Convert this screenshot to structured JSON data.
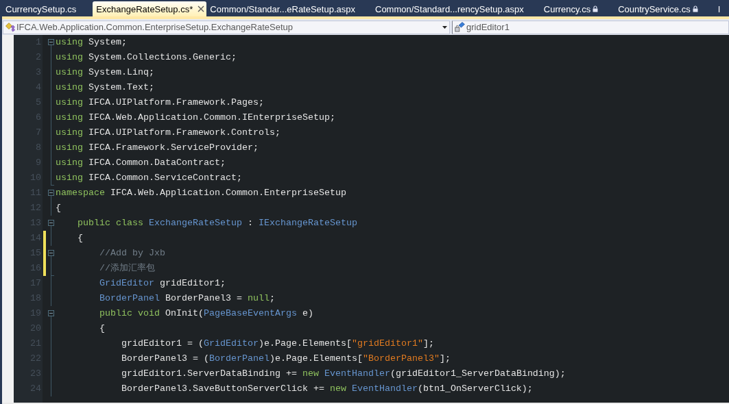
{
  "tabs": [
    {
      "label": "CurrencySetup.cs",
      "selected": false,
      "locked": false
    },
    {
      "label": "ExchangeRateSetup.cs*",
      "selected": true,
      "locked": false
    },
    {
      "label": "Common/Standar...eRateSetup.aspx",
      "selected": false,
      "locked": false
    },
    {
      "label": "Common/Standard...rencySetup.aspx",
      "selected": false,
      "locked": false
    },
    {
      "label": "Currency.cs",
      "selected": false,
      "locked": true
    },
    {
      "label": "CountryService.cs",
      "selected": false,
      "locked": true
    },
    {
      "label": "I",
      "selected": false,
      "locked": false
    }
  ],
  "navigation_bar": {
    "type_dropdown": "IFCA.Web.Application.Common.EnterpriseSetup.ExchangeRateSetup",
    "member_dropdown": "gridEditor1"
  },
  "editor": {
    "lines": [
      {
        "number": "1",
        "foldable": true,
        "fold_end": false,
        "changed": false,
        "tokens": [
          {
            "kind": "keyword",
            "text": "using"
          },
          {
            "kind": "plain",
            "text": " System;"
          }
        ]
      },
      {
        "number": "2",
        "foldable": false,
        "fold_end": false,
        "changed": false,
        "tokens": [
          {
            "kind": "keyword",
            "text": "using"
          },
          {
            "kind": "plain",
            "text": " System.Collections.Generic;"
          }
        ]
      },
      {
        "number": "3",
        "foldable": false,
        "fold_end": false,
        "changed": false,
        "tokens": [
          {
            "kind": "keyword",
            "text": "using"
          },
          {
            "kind": "plain",
            "text": " System.Linq;"
          }
        ]
      },
      {
        "number": "4",
        "foldable": false,
        "fold_end": false,
        "changed": false,
        "tokens": [
          {
            "kind": "keyword",
            "text": "using"
          },
          {
            "kind": "plain",
            "text": " System.Text;"
          }
        ]
      },
      {
        "number": "5",
        "foldable": false,
        "fold_end": false,
        "changed": false,
        "tokens": [
          {
            "kind": "keyword",
            "text": "using"
          },
          {
            "kind": "plain",
            "text": " IFCA.UIPlatform.Framework.Pages;"
          }
        ]
      },
      {
        "number": "6",
        "foldable": false,
        "fold_end": false,
        "changed": false,
        "tokens": [
          {
            "kind": "keyword",
            "text": "using"
          },
          {
            "kind": "plain",
            "text": " IFCA.Web.Application.Common.IEnterpriseSetup;"
          }
        ]
      },
      {
        "number": "7",
        "foldable": false,
        "fold_end": false,
        "changed": false,
        "tokens": [
          {
            "kind": "keyword",
            "text": "using"
          },
          {
            "kind": "plain",
            "text": " IFCA.UIPlatform.Framework.Controls;"
          }
        ]
      },
      {
        "number": "8",
        "foldable": false,
        "fold_end": false,
        "changed": false,
        "tokens": [
          {
            "kind": "keyword",
            "text": "using"
          },
          {
            "kind": "plain",
            "text": " IFCA.Framework.ServiceProvider;"
          }
        ]
      },
      {
        "number": "9",
        "foldable": false,
        "fold_end": false,
        "changed": false,
        "tokens": [
          {
            "kind": "keyword",
            "text": "using"
          },
          {
            "kind": "plain",
            "text": " IFCA.Common.DataContract;"
          }
        ]
      },
      {
        "number": "10",
        "foldable": false,
        "fold_end": true,
        "changed": false,
        "tokens": [
          {
            "kind": "keyword",
            "text": "using"
          },
          {
            "kind": "plain",
            "text": " IFCA.Common.ServiceContract;"
          }
        ]
      },
      {
        "number": "11",
        "foldable": true,
        "fold_end": false,
        "changed": false,
        "tokens": [
          {
            "kind": "keyword",
            "text": "namespace"
          },
          {
            "kind": "plain",
            "text": " IFCA.Web.Application.Common.EnterpriseSetup"
          }
        ]
      },
      {
        "number": "12",
        "foldable": false,
        "fold_end": false,
        "changed": false,
        "tokens": [
          {
            "kind": "plain",
            "text": "{"
          }
        ]
      },
      {
        "number": "13",
        "foldable": true,
        "fold_end": false,
        "changed": false,
        "tokens": [
          {
            "kind": "keyword",
            "text": "    public class "
          },
          {
            "kind": "type",
            "text": "ExchangeRateSetup"
          },
          {
            "kind": "plain",
            "text": " : "
          },
          {
            "kind": "type",
            "text": "IExchangeRateSetup"
          }
        ]
      },
      {
        "number": "14",
        "foldable": false,
        "fold_end": false,
        "changed": true,
        "tokens": [
          {
            "kind": "plain",
            "text": "    {"
          }
        ]
      },
      {
        "number": "15",
        "foldable": true,
        "fold_end": false,
        "changed": true,
        "tokens": [
          {
            "kind": "comment",
            "text": "        //Add by Jxb"
          }
        ]
      },
      {
        "number": "16",
        "foldable": false,
        "fold_end": true,
        "changed": true,
        "tokens": [
          {
            "kind": "comment",
            "text": "        //添加汇率包"
          }
        ]
      },
      {
        "number": "17",
        "foldable": false,
        "fold_end": false,
        "changed": false,
        "tokens": [
          {
            "kind": "type",
            "text": "        GridEditor"
          },
          {
            "kind": "plain",
            "text": " gridEditor1;"
          }
        ]
      },
      {
        "number": "18",
        "foldable": false,
        "fold_end": false,
        "changed": false,
        "tokens": [
          {
            "kind": "type",
            "text": "        BorderPanel"
          },
          {
            "kind": "plain",
            "text": " BorderPanel3 = "
          },
          {
            "kind": "keyword",
            "text": "null"
          },
          {
            "kind": "plain",
            "text": ";"
          }
        ]
      },
      {
        "number": "19",
        "foldable": true,
        "fold_end": false,
        "changed": false,
        "tokens": [
          {
            "kind": "keyword",
            "text": "        public void"
          },
          {
            "kind": "plain",
            "text": " OnInit("
          },
          {
            "kind": "type",
            "text": "PageBaseEventArgs"
          },
          {
            "kind": "plain",
            "text": " e)"
          }
        ]
      },
      {
        "number": "20",
        "foldable": false,
        "fold_end": false,
        "changed": false,
        "tokens": [
          {
            "kind": "plain",
            "text": "        {"
          }
        ]
      },
      {
        "number": "21",
        "foldable": false,
        "fold_end": false,
        "changed": false,
        "tokens": [
          {
            "kind": "plain",
            "text": "            gridEditor1 = ("
          },
          {
            "kind": "type",
            "text": "GridEditor"
          },
          {
            "kind": "plain",
            "text": ")e.Page.Elements["
          },
          {
            "kind": "string",
            "text": "\"gridEditor1\""
          },
          {
            "kind": "plain",
            "text": "];"
          }
        ]
      },
      {
        "number": "22",
        "foldable": false,
        "fold_end": false,
        "changed": false,
        "tokens": [
          {
            "kind": "plain",
            "text": "            BorderPanel3 = ("
          },
          {
            "kind": "type",
            "text": "BorderPanel"
          },
          {
            "kind": "plain",
            "text": ")e.Page.Elements["
          },
          {
            "kind": "string",
            "text": "\"BorderPanel3\""
          },
          {
            "kind": "plain",
            "text": "];"
          }
        ]
      },
      {
        "number": "23",
        "foldable": false,
        "fold_end": false,
        "changed": false,
        "tokens": [
          {
            "kind": "plain",
            "text": "            gridEditor1.ServerDataBinding += "
          },
          {
            "kind": "keyword",
            "text": "new "
          },
          {
            "kind": "type",
            "text": "EventHandler"
          },
          {
            "kind": "plain",
            "text": "(gridEditor1_ServerDataBinding);"
          }
        ]
      },
      {
        "number": "24",
        "foldable": false,
        "fold_end": false,
        "changed": false,
        "tokens": [
          {
            "kind": "plain",
            "text": "            BorderPanel3.SaveButtonServerClick += "
          },
          {
            "kind": "keyword",
            "text": "new "
          },
          {
            "kind": "type",
            "text": "EventHandler"
          },
          {
            "kind": "plain",
            "text": "(btn1_OnServerClick);"
          }
        ]
      }
    ]
  }
}
